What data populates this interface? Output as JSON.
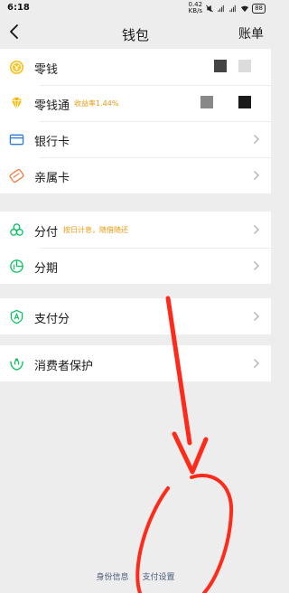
{
  "status_bar": {
    "time": "6:18",
    "net_speed_top": "0.42",
    "net_speed_bottom": "KB/s",
    "battery": "88"
  },
  "nav": {
    "title": "钱包",
    "right_label": "账单"
  },
  "sections": {
    "balance": [
      {
        "label": "零钱",
        "icon": "coin-icon"
      },
      {
        "label": "零钱通",
        "tag": "收益率1.44%",
        "icon": "diamond-icon"
      },
      {
        "label": "银行卡",
        "icon": "bank-card-icon"
      },
      {
        "label": "亲属卡",
        "icon": "family-card-icon"
      }
    ],
    "credit": [
      {
        "label": "分付",
        "tag": "按日计息，随借随还",
        "icon": "clover-icon"
      },
      {
        "label": "分期",
        "icon": "installment-icon"
      }
    ],
    "score": [
      {
        "label": "支付分",
        "icon": "pay-score-icon"
      }
    ],
    "protect": [
      {
        "label": "消费者保护",
        "icon": "shield-hands-icon"
      }
    ]
  },
  "footer": {
    "identity": "身份信息",
    "pay_settings": "支付设置"
  },
  "colors": {
    "accent_green": "#07c160",
    "tag_orange": "#e89a0c",
    "gold": "#f5b800",
    "annotation_red": "#ff2a1a"
  }
}
